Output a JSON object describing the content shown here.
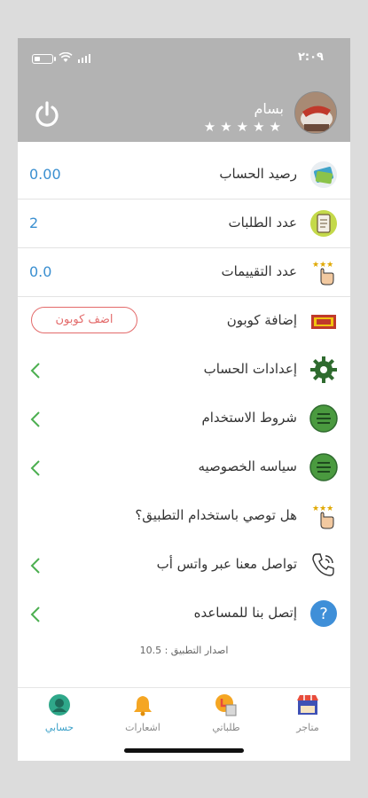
{
  "status_bar": {
    "time": "٢:٠٩"
  },
  "header": {
    "user_name": "بسام",
    "rating_stars": 5
  },
  "rows": [
    {
      "label": "رصيد الحساب",
      "value": "0.00",
      "icon": "wallet-icon"
    },
    {
      "label": "عدد الطلبات",
      "value": "2",
      "icon": "orders-icon"
    },
    {
      "label": "عدد التقييمات",
      "value": "0.0",
      "icon": "rating-hand-icon"
    },
    {
      "label": "إضافة كوبون",
      "button": "اضف كوبون",
      "icon": "coupon-icon"
    },
    {
      "label": "إعدادات الحساب",
      "icon": "gear-icon"
    },
    {
      "label": "شروط الاستخدام",
      "icon": "terms-icon"
    },
    {
      "label": "سياسه الخصوصيه",
      "icon": "privacy-icon"
    },
    {
      "label": "هل توصي باستخدام التطبيق؟",
      "icon": "recommend-icon"
    },
    {
      "label": "تواصل معنا عبر واتس أب",
      "icon": "phone-icon"
    },
    {
      "label": "إتصل بنا للمساعده",
      "icon": "help-icon"
    }
  ],
  "version": "اصدار التطبيق : 10.5",
  "tabs": [
    {
      "label": "متاجر",
      "icon": "store-icon"
    },
    {
      "label": "طلباتي",
      "icon": "my-orders-icon"
    },
    {
      "label": "اشعارات",
      "icon": "bell-icon"
    },
    {
      "label": "حسابي",
      "icon": "account-icon",
      "active": true
    }
  ],
  "colors": {
    "header_bg": "#b3b3b3",
    "value_blue": "#3a8fd0",
    "chevron_green": "#4caf50",
    "coupon_red": "#e36a6a",
    "active_tab": "#3aa0c8"
  }
}
